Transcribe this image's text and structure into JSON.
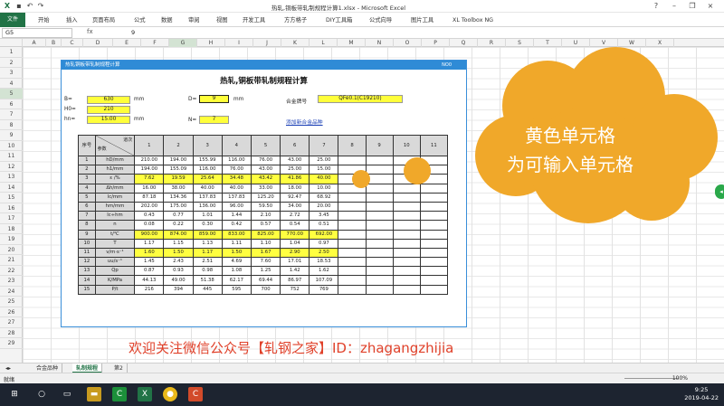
{
  "window": {
    "title": "热轧,铜板带轧制规程计算1.xlsx - Microsoft Excel",
    "file_tab": "文件"
  },
  "ribbon": {
    "tabs": [
      "开始",
      "插入",
      "页面布局",
      "公式",
      "数据",
      "审阅",
      "视图",
      "开发工具",
      "方方格子",
      "DIY工具箱",
      "公式向导",
      "图片工具",
      "XL Toolbox NG"
    ]
  },
  "formula": {
    "namebox": "G5",
    "fx": "fx",
    "value": "9"
  },
  "columns": [
    "A",
    "B",
    "C",
    "D",
    "E",
    "F",
    "G",
    "H",
    "I",
    "J",
    "K",
    "L",
    "M",
    "N",
    "O",
    "P",
    "Q",
    "R",
    "S",
    "T",
    "U",
    "V",
    "W",
    "X"
  ],
  "rows": [
    "1",
    "2",
    "3",
    "4",
    "5",
    "6",
    "7",
    "8",
    "9",
    "10",
    "11",
    "12",
    "13",
    "14",
    "15",
    "16",
    "17",
    "18",
    "19",
    "20",
    "21",
    "22",
    "23",
    "24",
    "25",
    "26",
    "27",
    "28",
    "29"
  ],
  "panel": {
    "header": "热轧铜板带轧制规程计算",
    "header_right": "NO0",
    "title": "热轧,铜板带轧制规程计算",
    "B_label": "B=",
    "B_val": "630",
    "B_unit": "mm",
    "H0_label": "H0=",
    "H0_val": "210",
    "H0_unit": "mm",
    "hn_label": "hn=",
    "hn_val": "15.00",
    "hn_unit": "mm",
    "D_label": "D=",
    "D_val": "9",
    "D_unit": "mm",
    "N_label": "N=",
    "N_val": "7",
    "alloy_label": "合金牌号",
    "alloy_val": "QFe0.1(C19210)",
    "add_link": "添加新合金品种"
  },
  "table": {
    "head_seq": "序号",
    "head_pass": "道次",
    "head_param": "参数",
    "passes": [
      "1",
      "2",
      "3",
      "4",
      "5",
      "6",
      "7",
      "8",
      "9",
      "10",
      "11"
    ],
    "rows": [
      {
        "idx": "1",
        "label": "hD/mm",
        "vals": [
          "210.00",
          "194.00",
          "155.99",
          "116.00",
          "76.00",
          "43.00",
          "25.00"
        ],
        "yellow": false
      },
      {
        "idx": "2",
        "label": "h1/mm",
        "vals": [
          "194.00",
          "155.09",
          "116.00",
          "76.00",
          "43.00",
          "25.00",
          "15.00"
        ],
        "yellow": false
      },
      {
        "idx": "3",
        "label": "ε /%",
        "vals": [
          "7.62",
          "19.59",
          "25.64",
          "34.48",
          "43.42",
          "41.86",
          "40.00"
        ],
        "yellow": true
      },
      {
        "idx": "4",
        "label": "Δh/mm",
        "vals": [
          "16.00",
          "38.00",
          "40.00",
          "40.00",
          "33.00",
          "18.00",
          "10.00"
        ],
        "yellow": false
      },
      {
        "idx": "5",
        "label": "lc/mm",
        "vals": [
          "87.18",
          "134.36",
          "137.83",
          "137.83",
          "125.20",
          "92.47",
          "68.92"
        ],
        "yellow": false
      },
      {
        "idx": "6",
        "label": "hm/mm",
        "vals": [
          "202.00",
          "175.00",
          "136.00",
          "96.00",
          "59.50",
          "34.00",
          "20.00"
        ],
        "yellow": false
      },
      {
        "idx": "7",
        "label": "lc÷hm",
        "vals": [
          "0.43",
          "0.77",
          "1.01",
          "1.44",
          "2.10",
          "2.72",
          "3.45"
        ],
        "yellow": false
      },
      {
        "idx": "8",
        "label": "n",
        "vals": [
          "0.08",
          "0.22",
          "0.30",
          "0.42",
          "0.57",
          "0.54",
          "0.51"
        ],
        "yellow": false
      },
      {
        "idx": "9",
        "label": "t/℃",
        "vals": [
          "900.00",
          "874.00",
          "859.00",
          "833.00",
          "825.00",
          "770.00",
          "692.00"
        ],
        "yellow": true
      },
      {
        "idx": "10",
        "label": "T",
        "vals": [
          "1.17",
          "1.15",
          "1.13",
          "1.11",
          "1.10",
          "1.04",
          "0.97"
        ],
        "yellow": false
      },
      {
        "idx": "11",
        "label": "v/m·s⁻¹",
        "vals": [
          "1.60",
          "1.50",
          "1.17",
          "1.50",
          "1.67",
          "2.90",
          "2.50"
        ],
        "yellow": true
      },
      {
        "idx": "12",
        "label": "uu/s⁻¹",
        "vals": [
          "1.45",
          "2.43",
          "2.51",
          "4.69",
          "7.60",
          "17.01",
          "18.53"
        ],
        "yellow": false
      },
      {
        "idx": "13",
        "label": "Qp",
        "vals": [
          "0.87",
          "0.93",
          "0.98",
          "1.08",
          "1.25",
          "1.42",
          "1.62"
        ],
        "yellow": false
      },
      {
        "idx": "14",
        "label": "K/MPa",
        "vals": [
          "44.13",
          "49.00",
          "51.38",
          "62.17",
          "69.44",
          "86.97",
          "107.09"
        ],
        "yellow": false
      },
      {
        "idx": "15",
        "label": "P/t",
        "vals": [
          "216",
          "394",
          "445",
          "595",
          "700",
          "752",
          "769"
        ],
        "yellow": false
      }
    ]
  },
  "cloud": {
    "line1": "黄色单元格",
    "line2": "为可输入单元格"
  },
  "caption": "欢迎关注微信公众号【轧钢之家】ID：zhagangzhijia",
  "sheets": [
    "合金品种",
    "轧制规程",
    "第2"
  ],
  "status": {
    "ready": "就绪",
    "zoom": "100%"
  },
  "clock": {
    "time": "9:25",
    "date": "2019-04-22"
  },
  "colors": {
    "excel_green": "#217346",
    "input_yellow": "#ffff3a",
    "panel_blue": "#2f8bd6",
    "cloud_orange": "#f0a82a",
    "caption_red": "#e0412a"
  }
}
